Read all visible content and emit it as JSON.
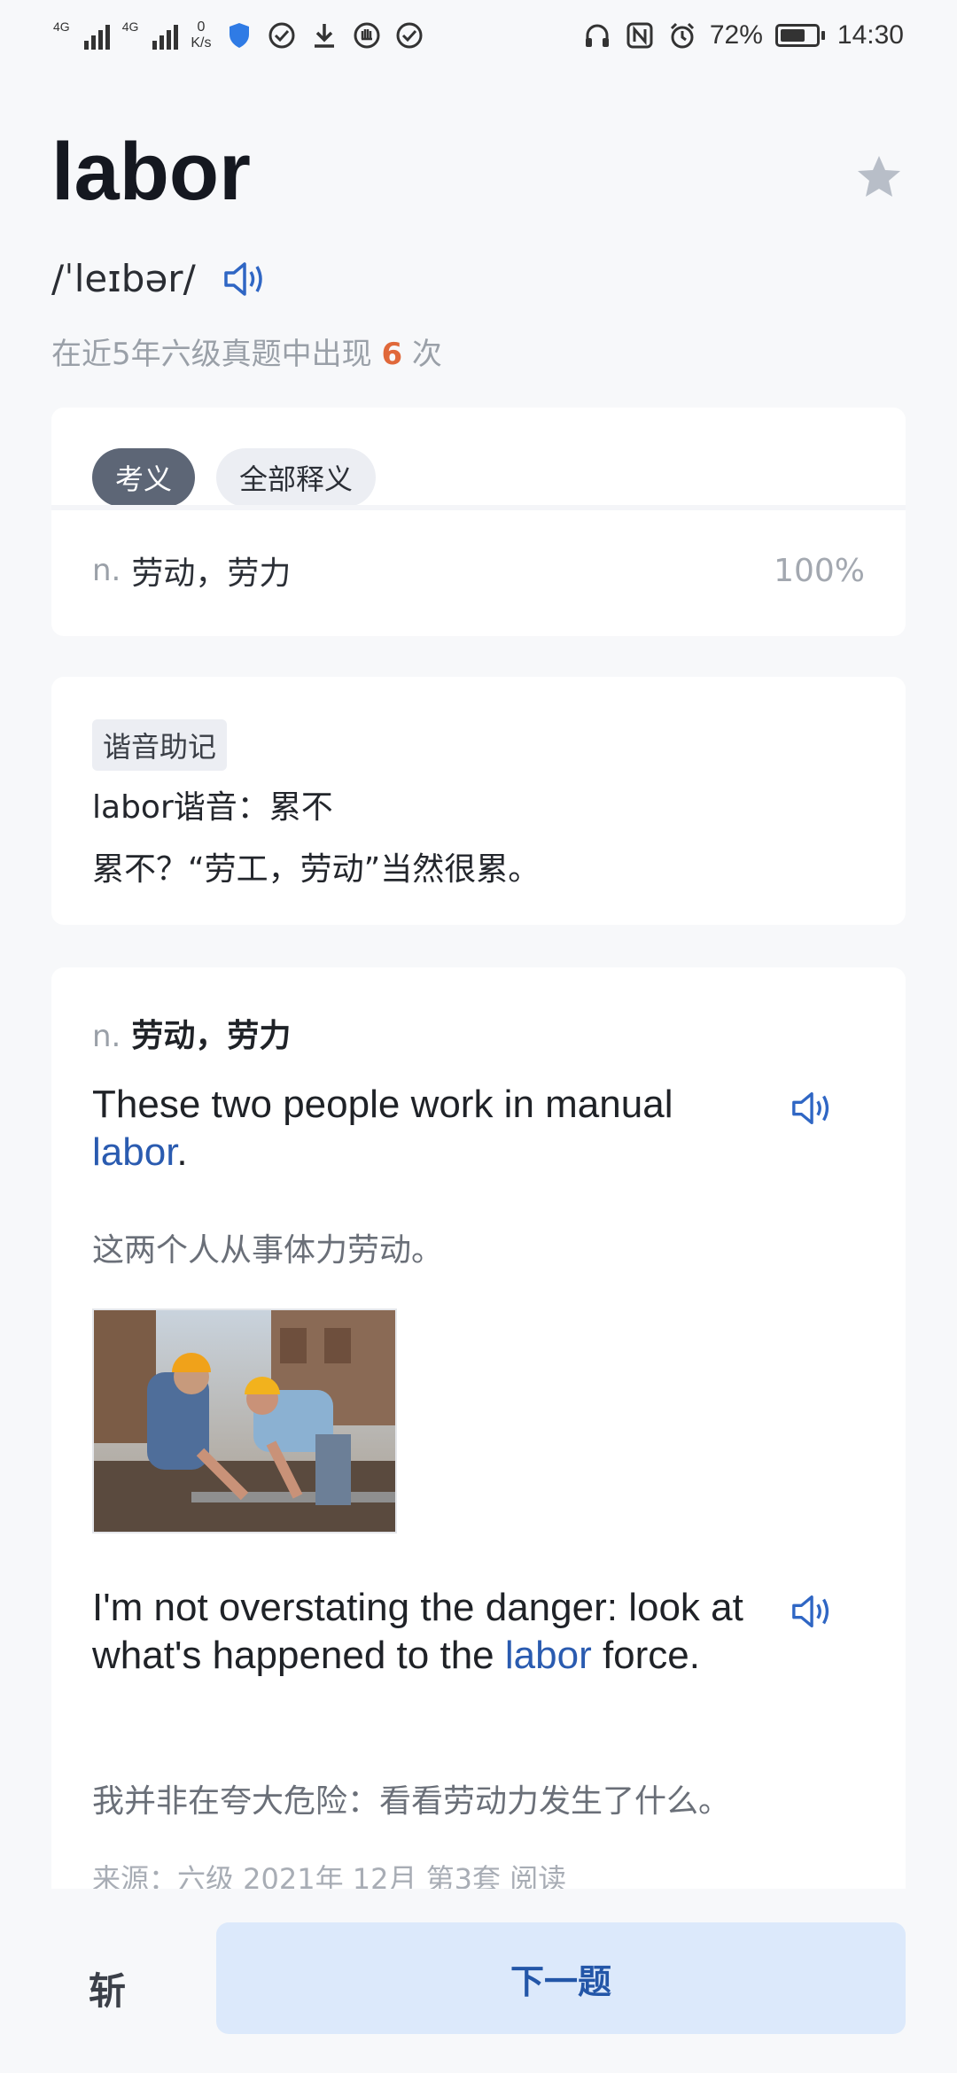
{
  "status_bar": {
    "net1": "4G",
    "net2": "4G",
    "speed_value": "0",
    "speed_unit": "K/s",
    "battery": "72%",
    "battery_level": 0.72,
    "time": "14:30"
  },
  "word": {
    "title": "labor",
    "phonetic": "/ˈleɪbər/",
    "frequency_prefix": "在近5年六级真题中出现 ",
    "frequency_count": "6",
    "frequency_suffix": " 次",
    "favorited": false
  },
  "meaning_card": {
    "tabs": [
      {
        "label": "考义",
        "active": true
      },
      {
        "label": "全部释义",
        "active": false
      }
    ],
    "pos": "n.",
    "meaning": "劳动，劳力",
    "percent": "100%"
  },
  "mnemonic_card": {
    "tag": "谐音助记",
    "line1": "labor谐音：累不",
    "line2": "累不？“劳工，劳动”当然很累。"
  },
  "examples_card": {
    "pos": "n.",
    "meaning": "劳动，劳力",
    "examples": [
      {
        "en_before": "These two people work in manual ",
        "en_highlight": "labor",
        "en_after": ".",
        "cn": "这两个人从事体力劳动。"
      },
      {
        "en_before": "I'm not overstating the danger: look at what's happened to the ",
        "en_highlight": "labor",
        "en_after": " force.",
        "cn": "我并非在夸大危险：看看劳动力发生了什么。"
      }
    ],
    "source": "来源：六级 2021年 12月 第3套 阅读"
  },
  "bottom_bar": {
    "slash_label": "斩",
    "next_label": "下一题"
  },
  "colors": {
    "accent_blue": "#2a5bb0",
    "count_orange": "#e0683a",
    "next_bg": "#dce9fb"
  }
}
